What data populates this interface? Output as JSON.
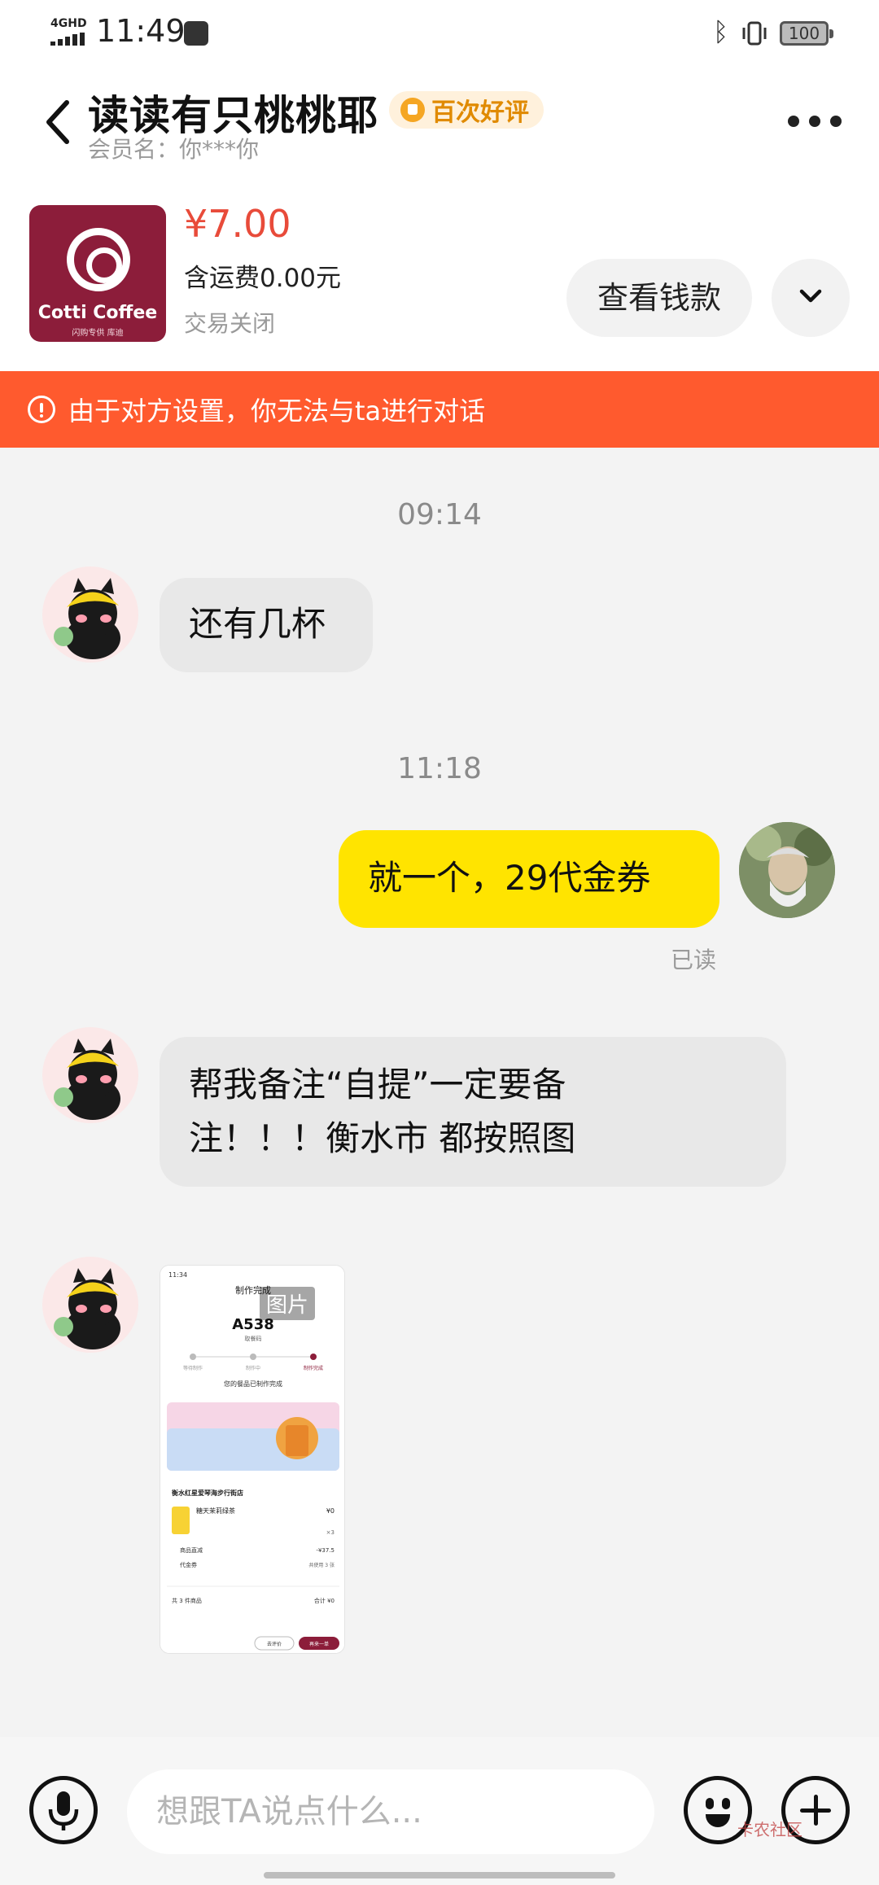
{
  "status_bar": {
    "network": "4GHD",
    "time": "11:49",
    "battery": "100"
  },
  "header": {
    "title": "读读有只桃桃耶",
    "badge": "百次好评",
    "member": "会员名：你***你"
  },
  "product": {
    "brand": "Cotti Coffee",
    "brand_sub": "闪购专供 库迪",
    "price": "¥7.00",
    "shipping": "含运费0.00元",
    "status": "交易关闭",
    "view_button": "查看钱款"
  },
  "banner": {
    "text": "由于对方设置，你无法与ta进行对话"
  },
  "messages": {
    "time_1": "09:14",
    "msg_1": "还有几杯",
    "time_2": "11:18",
    "msg_2": "就一个，29代金券",
    "read_status": "已读",
    "msg_3_line_1": "帮我备注“自提”一定要备",
    "msg_3_line_2": "注！！！衡水市 都按照图",
    "image_label": "图片"
  },
  "screenshot_content": {
    "time": "11:34",
    "title": "制作完成",
    "pickup_code": "A538",
    "pickup_label": "取餐码",
    "steps": [
      "等待制作",
      "制作中",
      "制作完成"
    ],
    "ready_text": "您的餐品已制作完成",
    "store": "衡水红星爱琴海步行街店",
    "item_name": "糖天茉莉绿茶",
    "item_price": "¥0",
    "item_qty": "×3",
    "discount_label": "商品直减",
    "discount_value": "-¥37.5",
    "voucher_label": "代金券",
    "voucher_value": "共使用 3 张",
    "total_label": "共 3 件商品",
    "total_value": "合计 ¥0",
    "btn_invoice": "去评价",
    "btn_again": "再来一单"
  },
  "input_bar": {
    "placeholder": "想跟TA说点什么..."
  },
  "watermark": "卡农社区",
  "colors": {
    "price_red": "#e84b3a",
    "banner_orange": "#ff5a2e",
    "my_bubble": "#ffe400",
    "other_bubble": "#e8e8e8",
    "badge_orange": "#e08a00",
    "brand_wine": "#8c1d3a"
  },
  "icons": {
    "back": "chevron-left-icon",
    "more": "more-dots-icon",
    "expand": "chevron-down-icon",
    "warning": "exclamation-circle-icon",
    "voice": "microphone-icon",
    "emoji": "smiley-icon",
    "add": "plus-circle-icon"
  }
}
